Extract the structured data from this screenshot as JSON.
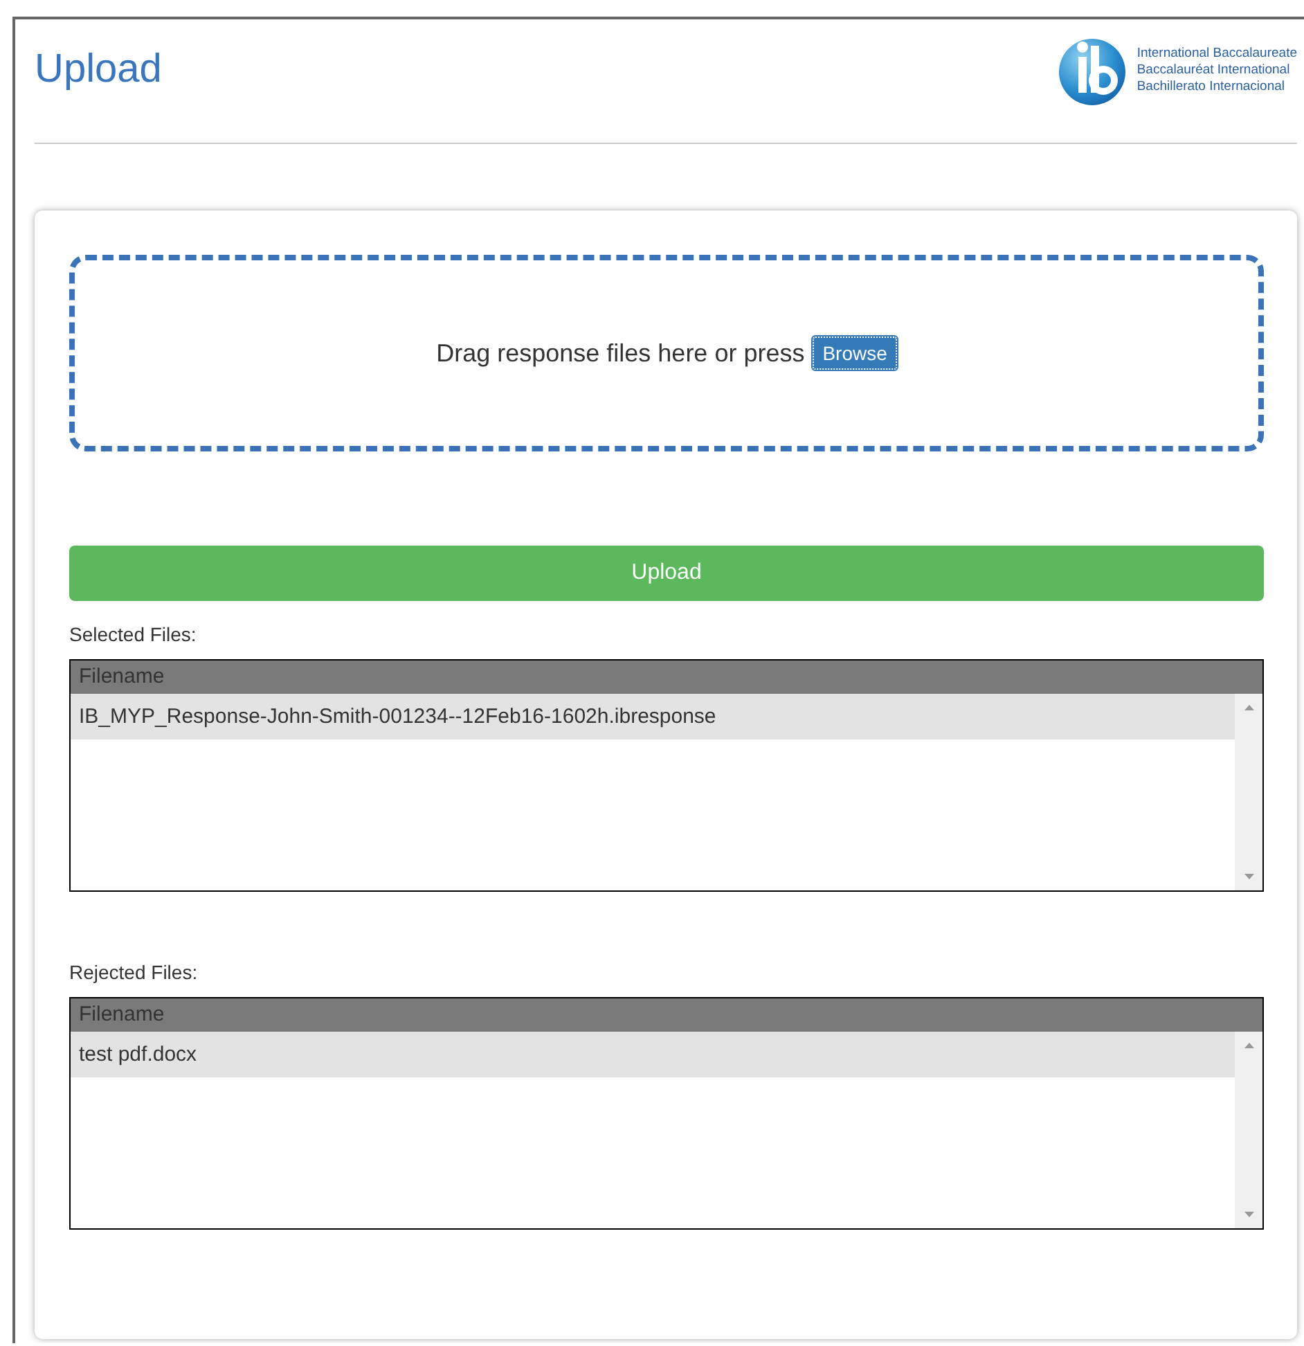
{
  "header": {
    "title": "Upload",
    "logo_lines": [
      "International Baccalaureate",
      "Baccalauréat International",
      "Bachillerato Internacional"
    ]
  },
  "dropzone": {
    "text": "Drag response files here or press",
    "browse_label": "Browse"
  },
  "upload_button": "Upload",
  "file_lists": [
    {
      "label": "Selected Files:",
      "column": "Filename",
      "rows": [
        {
          "name": "IB_MYP_Response-John-Smith-001234--12Feb16-1602h.ibresponse",
          "selected": true
        }
      ]
    },
    {
      "label": "Rejected Files:",
      "column": "Filename",
      "rows": [
        {
          "name": "test pdf.docx",
          "selected": true
        }
      ]
    }
  ]
}
